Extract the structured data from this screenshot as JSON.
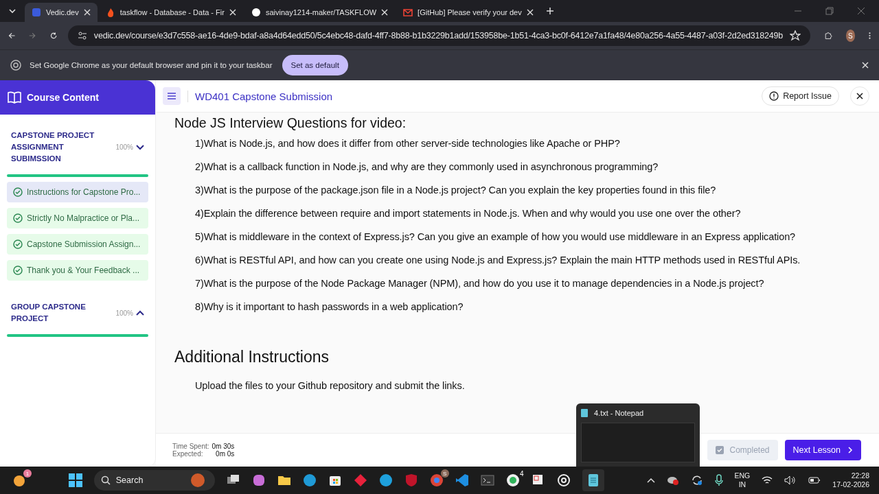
{
  "browser": {
    "tabs": [
      {
        "title": "Vedic.dev",
        "selected": true,
        "kind": "vedic"
      },
      {
        "title": "taskflow - Database - Data - Fir",
        "selected": false,
        "kind": "fire"
      },
      {
        "title": "saivinay1214-maker/TASKFLOW",
        "selected": false,
        "kind": "github"
      },
      {
        "title": "[GitHub] Please verify your dev",
        "selected": false,
        "kind": "mail"
      }
    ],
    "url": "vedic.dev/course/e3d7c558-ae16-4de9-bdaf-a8a4d64edd50/5c4ebc48-dafd-4ff7-8b88-b1b3229b1add/153958be-1b51-4ca3-bc0f-6412e7a1fa48/4e80a256-4a55-4487-a03f-2d2ed318249b",
    "profile": "S",
    "infobar": {
      "message": "Set Google Chrome as your default browser and pin it to your taskbar",
      "button": "Set as default"
    }
  },
  "sidebar": {
    "title": "Course Content",
    "sections": [
      {
        "title": "CAPSTONE PROJECT ASSIGNMENT SUBIMSSION",
        "progress": "100%",
        "expanded": true,
        "lessons": [
          {
            "title": "Instructions for Capstone Pro...",
            "selected": true
          },
          {
            "title": "Strictly No Malpractice or Pla...",
            "selected": false
          },
          {
            "title": "Capstone Submission Assign...",
            "selected": false
          },
          {
            "title": "Thank you & Your Feedback ...",
            "selected": false
          }
        ]
      },
      {
        "title": "GROUP CAPSTONE PROJECT",
        "progress": "100%",
        "expanded": false
      }
    ]
  },
  "header": {
    "title": "WD401 Capstone Submission",
    "report": "Report Issue"
  },
  "content": {
    "heading": "Node JS Interview Questions for video:",
    "questions": [
      "1)What is Node.js, and how does it differ from other server-side technologies like Apache or PHP?",
      "2)What is a callback function in Node.js, and why are they commonly used in asynchronous programming?",
      "3)What is the purpose of the package.json file in a Node.js project? Can you explain the key properties found in this file?",
      "4)Explain the difference between require and import statements in Node.js. When and why would you use one over the other?",
      "5)What is middleware in the context of Express.js? Can you give an example of how you would use middleware in an Express application?",
      "6)What is RESTful API, and how can you create one using Node.js and Express.js? Explain the main HTTP methods used in RESTful APIs.",
      "7)What is the purpose of the Node Package Manager (NPM), and how do you use it to manage dependencies in a Node.js project?",
      "8)Why is it important to hash passwords in a web application?"
    ],
    "heading2": "Additional Instructions",
    "paragraph": "Upload the files to your Github repository and submit the links."
  },
  "footer": {
    "time_spent_label": "Time Spent:",
    "time_spent": "0m 30s",
    "expected_label": "Expected:",
    "expected": "0m 0s",
    "completed": {
      "label": "Completed",
      "disabled": true
    },
    "next": "Next Lesson"
  },
  "preview": {
    "title": "4.txt - Notepad"
  },
  "taskbar": {
    "weather_badge": "1",
    "search": "Search",
    "whatsapp_badge": "4",
    "chrome_badge": "S",
    "lang": "ENG",
    "region": "IN",
    "time": "22:28",
    "date": "17-02-2026"
  }
}
